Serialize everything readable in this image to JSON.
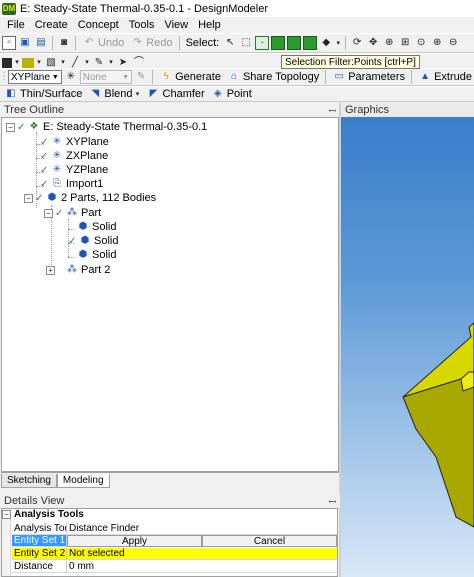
{
  "window": {
    "title": "E: Steady-State Thermal-0.35-0.1 - DesignModeler",
    "app_icon_text": "DM"
  },
  "menu": [
    "File",
    "Create",
    "Concept",
    "Tools",
    "View",
    "Help"
  ],
  "toolbar1": {
    "undo_label": "Undo",
    "redo_label": "Redo",
    "select_label": "Select:"
  },
  "tooltip": {
    "text": "Selection Filter:Points [ctrl+P]"
  },
  "toolbar3": {
    "plane_value": "XYPlane",
    "sketch_value": "None",
    "generate_label": "Generate",
    "share_topology_label": "Share Topology",
    "parameters_label": "Parameters",
    "extrude_label": "Extrude"
  },
  "toolbar4": {
    "thin_surface_label": "Thin/Surface",
    "blend_label": "Blend",
    "chamfer_label": "Chamfer",
    "point_label": "Point"
  },
  "tree_outline": {
    "header": "Tree Outline",
    "nodes": {
      "root": "E: Steady-State Thermal-0.35-0.1",
      "xyplane": "XYPlane",
      "zxplane": "ZXPlane",
      "yzplane": "YZPlane",
      "import1": "Import1",
      "parts": "2 Parts, 112 Bodies",
      "part": "Part",
      "solid1": "Solid",
      "solid2": "Solid",
      "solid3": "Solid",
      "part2": "Part 2"
    }
  },
  "tabs": {
    "sketching": "Sketching",
    "modeling": "Modeling"
  },
  "graphics": {
    "header": "Graphics"
  },
  "details_view": {
    "header": "Details View",
    "section": "Analysis Tools",
    "rows": {
      "analysis_tool_label": "Analysis Tool",
      "analysis_tool_value": "Distance Finder",
      "entity_set1_label": "Entity Set 1",
      "apply_label": "Apply",
      "cancel_label": "Cancel",
      "entity_set2_label": "Entity Set 2",
      "entity_set2_value": "Not selected",
      "distance_label": "Distance",
      "distance_value": "0 mm"
    }
  },
  "colors": {
    "model_face": "#c9c900",
    "model_side": "#8a8a00",
    "model_top": "#e0e000",
    "selection_blue": "#3399ff",
    "highlight_yellow": "#ffff00"
  }
}
